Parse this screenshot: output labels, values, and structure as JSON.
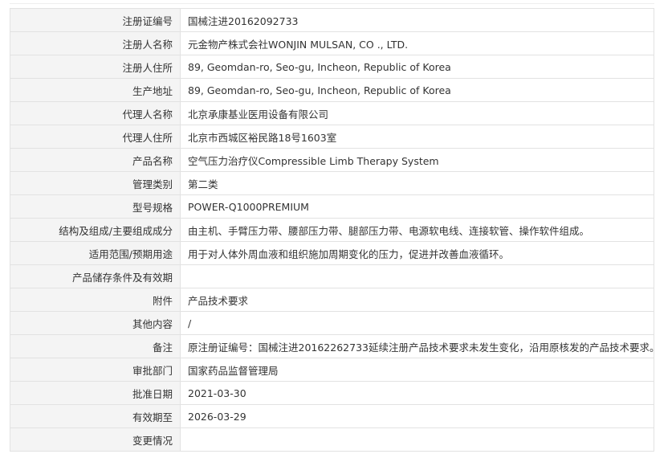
{
  "rows": [
    {
      "label": "注册证编号",
      "value": "国械注进20162092733"
    },
    {
      "label": "注册人名称",
      "value": "元金物产株式会社WONJIN MULSAN, CO ., LTD."
    },
    {
      "label": "注册人住所",
      "value": "89, Geomdan-ro, Seo-gu, Incheon, Republic of Korea"
    },
    {
      "label": "生产地址",
      "value": "89, Geomdan-ro, Seo-gu, Incheon, Republic of Korea"
    },
    {
      "label": "代理人名称",
      "value": "北京承康基业医用设备有限公司"
    },
    {
      "label": "代理人住所",
      "value": "北京市西城区裕民路18号1603室"
    },
    {
      "label": "产品名称",
      "value": "空气压力治疗仪Compressible Limb Therapy System"
    },
    {
      "label": "管理类别",
      "value": "第二类"
    },
    {
      "label": "型号规格",
      "value": "POWER-Q1000PREMIUM"
    },
    {
      "label": "结构及组成/主要组成成分",
      "value": "由主机、手臂压力带、腰部压力带、腿部压力带、电源软电线、连接软管、操作软件组成。"
    },
    {
      "label": "适用范围/预期用途",
      "value": "用于对人体外周血液和组织施加周期变化的压力，促进并改善血液循环。"
    },
    {
      "label": "产品储存条件及有效期",
      "value": ""
    },
    {
      "label": "附件",
      "value": "产品技术要求"
    },
    {
      "label": "其他内容",
      "value": "/"
    },
    {
      "label": "备注",
      "value": "原注册证编号：国械注进20162262733延续注册产品技术要求未发生变化，沿用原核发的产品技术要求。"
    },
    {
      "label": "审批部门",
      "value": "国家药品监督管理局"
    },
    {
      "label": "批准日期",
      "value": "2021-03-30"
    },
    {
      "label": "有效期至",
      "value": "2026-03-29"
    },
    {
      "label": "变更情况",
      "value": ""
    }
  ]
}
